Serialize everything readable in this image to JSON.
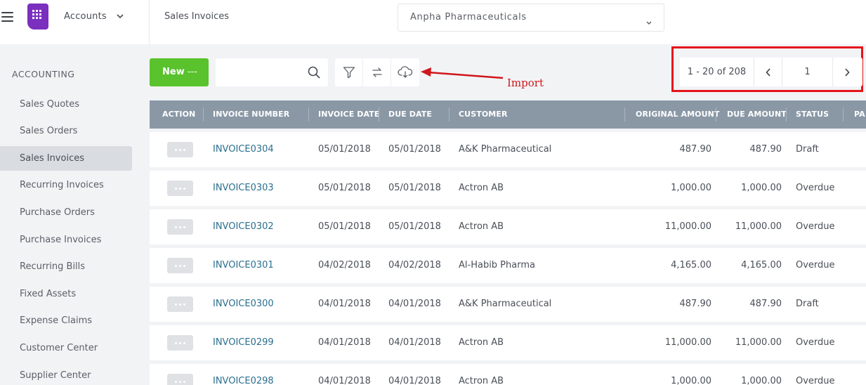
{
  "topbar": {
    "app_name": "Accounts",
    "page_title": "Sales Invoices",
    "company": "Anpha Pharmaceuticals"
  },
  "sidebar": {
    "section": "ACCOUNTING",
    "items": [
      {
        "label": "Sales Quotes",
        "active": false
      },
      {
        "label": "Sales Orders",
        "active": false
      },
      {
        "label": "Sales Invoices",
        "active": true
      },
      {
        "label": "Recurring Invoices",
        "active": false
      },
      {
        "label": "Purchase Orders",
        "active": false
      },
      {
        "label": "Purchase Invoices",
        "active": false
      },
      {
        "label": "Recurring Bills",
        "active": false
      },
      {
        "label": "Fixed Assets",
        "active": false
      },
      {
        "label": "Expense Claims",
        "active": false
      },
      {
        "label": "Customer Center",
        "active": false
      },
      {
        "label": "Supplier Center",
        "active": false
      }
    ]
  },
  "toolbar": {
    "new_label": "New",
    "new_dots": "---",
    "search_value": "",
    "filter_icon": "filter-icon",
    "sync_icon": "arrows-exchange-icon",
    "import_icon": "cloud-download-icon"
  },
  "annotation": {
    "text": "Import",
    "color": "#d0161b"
  },
  "pager": {
    "range": "1 - 20 of 208",
    "page": "1"
  },
  "table": {
    "columns": [
      "ACTION",
      "INVOICE NUMBER",
      "INVOICE DATE",
      "DUE DATE",
      "CUSTOMER",
      "ORIGINAL AMOUNT",
      "DUE AMOUNT",
      "STATUS",
      "PA"
    ],
    "rows": [
      {
        "invoice": "INVOICE0304",
        "invoice_date": "05/01/2018",
        "due_date": "05/01/2018",
        "customer": "A&K Pharmaceutical",
        "original": "487.90",
        "due": "487.90",
        "status": "Draft"
      },
      {
        "invoice": "INVOICE0303",
        "invoice_date": "05/01/2018",
        "due_date": "05/01/2018",
        "customer": "Actron AB",
        "original": "1,000.00",
        "due": "1,000.00",
        "status": "Overdue"
      },
      {
        "invoice": "INVOICE0302",
        "invoice_date": "05/01/2018",
        "due_date": "05/01/2018",
        "customer": "Actron AB",
        "original": "11,000.00",
        "due": "11,000.00",
        "status": "Overdue"
      },
      {
        "invoice": "INVOICE0301",
        "invoice_date": "04/02/2018",
        "due_date": "04/02/2018",
        "customer": "Al-Habib Pharma",
        "original": "4,165.00",
        "due": "4,165.00",
        "status": "Overdue"
      },
      {
        "invoice": "INVOICE0300",
        "invoice_date": "04/01/2018",
        "due_date": "04/01/2018",
        "customer": "A&K Pharmaceutical",
        "original": "487.90",
        "due": "487.90",
        "status": "Draft"
      },
      {
        "invoice": "INVOICE0299",
        "invoice_date": "04/01/2018",
        "due_date": "04/01/2018",
        "customer": "Actron AB",
        "original": "11,000.00",
        "due": "11,000.00",
        "status": "Overdue"
      },
      {
        "invoice": "INVOICE0298",
        "invoice_date": "04/01/2018",
        "due_date": "04/01/2018",
        "customer": "Actron AB",
        "original": "1,000.00",
        "due": "1,000.00",
        "status": "Overdue"
      }
    ]
  },
  "colors": {
    "brand": "#7b2fbe",
    "new_button": "#59c22c",
    "table_header": "#8a98a6",
    "link": "#2a6f8f",
    "highlight": "#e5141a"
  }
}
